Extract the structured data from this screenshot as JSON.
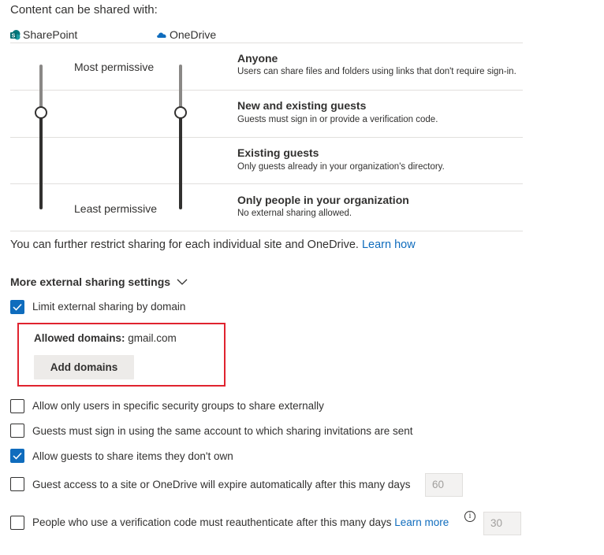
{
  "heading": "Content can be shared with:",
  "services": {
    "sharepoint": {
      "label": "SharePoint",
      "icon": "sharepoint-icon",
      "color": "#038387"
    },
    "onedrive": {
      "label": "OneDrive",
      "icon": "onedrive-icon",
      "color": "#0f6cbd"
    }
  },
  "slider": {
    "most_label": "Most permissive",
    "least_label": "Least permissive",
    "sharepoint_level": "New and existing guests",
    "onedrive_level": "New and existing guests"
  },
  "options": [
    {
      "title": "Anyone",
      "desc": "Users can share files and folders using links that don't require sign-in."
    },
    {
      "title": "New and existing guests",
      "desc": "Guests must sign in or provide a verification code."
    },
    {
      "title": "Existing guests",
      "desc": "Only guests already in your organization's directory."
    },
    {
      "title": "Only people in your organization",
      "desc": "No external sharing allowed."
    }
  ],
  "restrict": {
    "text": "You can further restrict sharing for each individual site and OneDrive.",
    "link": "Learn how"
  },
  "more_settings": {
    "label": "More external sharing settings",
    "icon": "chevron-down-icon"
  },
  "settings": {
    "limit_domain": {
      "label": "Limit external sharing by domain",
      "checked": true
    },
    "allowed_domains": {
      "label": "Allowed domains:",
      "value": "gmail.com",
      "button": "Add domains"
    },
    "security_groups": {
      "label": "Allow only users in specific security groups to share externally",
      "checked": false
    },
    "same_account": {
      "label": "Guests must sign in using the same account to which sharing invitations are sent",
      "checked": false
    },
    "guests_share": {
      "label": "Allow guests to share items they don't own",
      "checked": true
    },
    "guest_expire": {
      "label": "Guest access to a site or OneDrive will expire automatically after this many days",
      "checked": false,
      "value": "60"
    },
    "reauth": {
      "label": "People who use a verification code must reauthenticate after this many days",
      "link": "Learn more",
      "checked": false,
      "value": "30",
      "info_icon": "info-icon"
    }
  },
  "colors": {
    "accent": "#0f6cbd",
    "highlight_box": "#e0232f"
  }
}
